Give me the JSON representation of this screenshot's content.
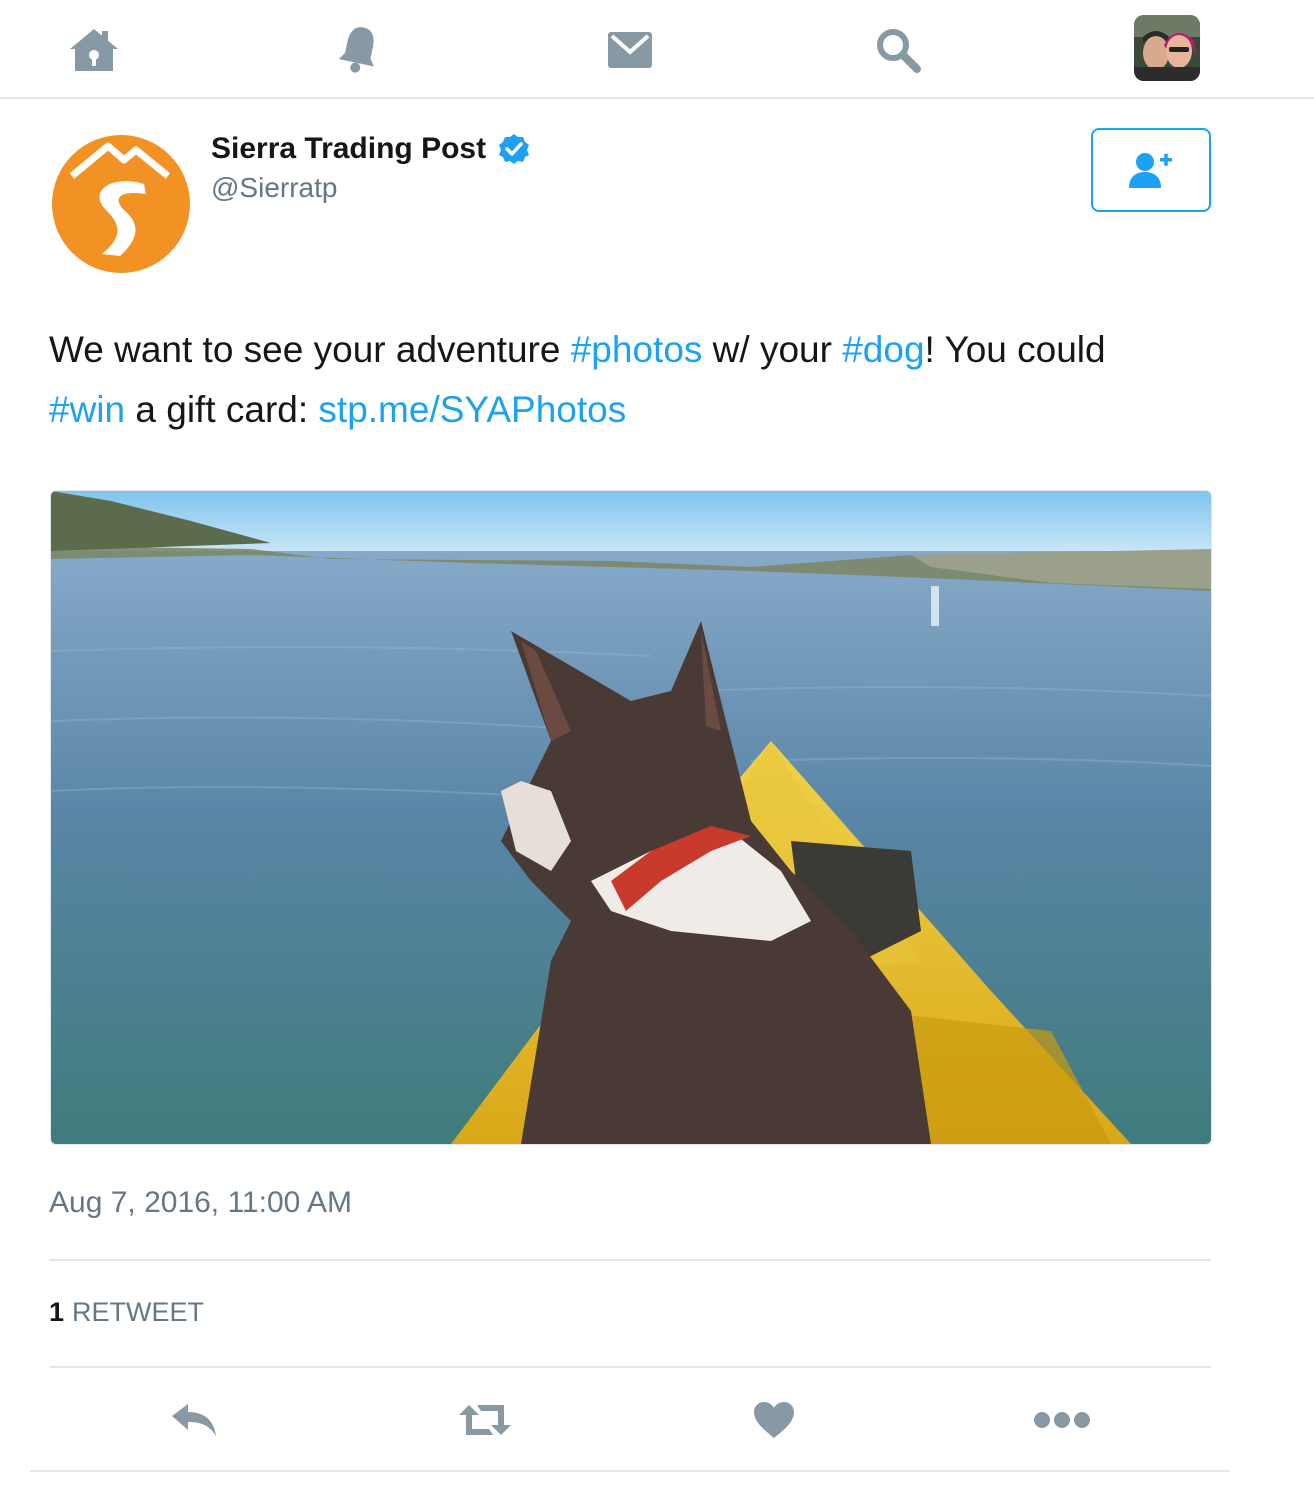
{
  "nav": {
    "items": [
      {
        "icon": "home-icon"
      },
      {
        "icon": "bell-icon"
      },
      {
        "icon": "mail-icon"
      },
      {
        "icon": "search-icon"
      },
      {
        "icon": "profile-avatar"
      }
    ]
  },
  "tweet": {
    "author": {
      "name": "Sierra Trading Post",
      "handle": "@Sierratp",
      "verified": true
    },
    "text": {
      "p1": "We want to see your adventure ",
      "h1": "#photos",
      "p2": " w/ your ",
      "h2": "#dog",
      "p3": "! You could ",
      "h3": "#win",
      "p4": " a gift card: ",
      "link": "stp.me/SYAPhotos"
    },
    "timestamp": "Aug 7, 2016, 11:00 AM",
    "stats": {
      "retweet_count": "1",
      "retweet_label": "RETWEET"
    }
  },
  "colors": {
    "accent": "#1da1f2",
    "secondary_text": "#657786",
    "icon_gray": "#8899a6",
    "brand_orange": "#f39224",
    "divider": "#e1e8ed"
  }
}
